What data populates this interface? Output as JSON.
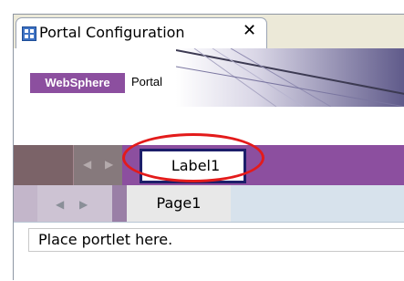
{
  "editor_tab": {
    "icon": "portal-config-icon",
    "title": "Portal Configuration",
    "close_glyph": "✕"
  },
  "banner": {
    "logo_brand": "WebSphere",
    "logo_product": "Portal"
  },
  "nav": {
    "label_tab": "Label1",
    "page_tab": "Page1",
    "left_arrow": "◀",
    "right_arrow": "▶"
  },
  "content": {
    "placeholder": "Place portlet here."
  },
  "colors": {
    "purple": "#8c4f9f",
    "navy_border": "#1c1e6a",
    "highlight_ring": "#e31b1b"
  }
}
